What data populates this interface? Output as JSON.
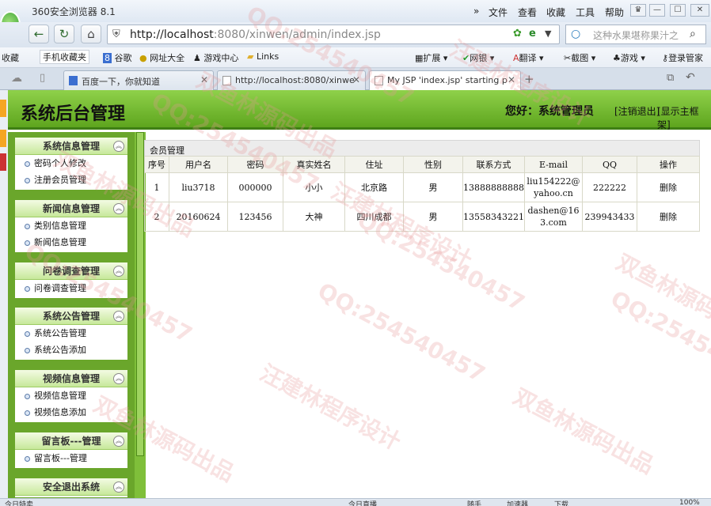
{
  "browser": {
    "app_title": "360安全浏览器 8.1",
    "menus": [
      "文件",
      "查看",
      "收藏",
      "工具",
      "帮助"
    ],
    "url_host": "http://localhost",
    "url_rest": ":8080/xinwen/admin/index.jsp",
    "search_placeholder": "这种水果堪称果汁之",
    "favorites": [
      "收藏",
      "手机收藏夹",
      "谷歌",
      "网址大全",
      "游戏中心",
      "Links",
      "扩展",
      "网银",
      "翻译",
      "截图",
      "游戏",
      "登录管家"
    ],
    "tabs": [
      {
        "label": "百度一下，你就知道",
        "active": false
      },
      {
        "label": "http://localhost:8080/xinwe",
        "active": false
      },
      {
        "label": "My JSP 'index.jsp' starting p",
        "active": true
      }
    ],
    "status_left": "今日特卖",
    "status_right": [
      "今日直播",
      "随手",
      "加速器",
      "下载",
      "100%"
    ]
  },
  "page": {
    "system_name": "系统后台管理",
    "greeting": "您好：系统管理员",
    "logout": "[注销退出]",
    "show_frame": "[显示主框架]",
    "breadcrumb": "会员管理"
  },
  "sidebar": {
    "groups": [
      {
        "title": "系统信息管理",
        "items": [
          "密码个人修改",
          "注册会员管理"
        ]
      },
      {
        "title": "新闻信息管理",
        "items": [
          "类别信息管理",
          "新闻信息管理"
        ]
      },
      {
        "title": "问卷调查管理",
        "items": [
          "问卷调查管理"
        ]
      },
      {
        "title": "系统公告管理",
        "items": [
          "系统公告管理",
          "系统公告添加"
        ]
      },
      {
        "title": "视频信息管理",
        "items": [
          "视频信息管理",
          "视频信息添加"
        ]
      },
      {
        "title": "留言板---管理",
        "items": [
          "留言板---管理"
        ]
      },
      {
        "title": "安全退出系统",
        "items": []
      }
    ]
  },
  "table": {
    "headers": [
      "序号",
      "用户名",
      "密码",
      "真实姓名",
      "住址",
      "性别",
      "联系方式",
      "E-mail",
      "QQ",
      "操作"
    ],
    "rows": [
      [
        "1",
        "liu3718",
        "000000",
        "小小",
        "北京路",
        "男",
        "13888888888",
        "liu154222@yahoo.cn",
        "222222",
        "删除"
      ],
      [
        "2",
        "20160624",
        "123456",
        "大神",
        "四川成都",
        "男",
        "13558343221",
        "dashen@163.com",
        "239943433",
        "删除"
      ]
    ]
  },
  "watermarks": [
    "QQ:254540457",
    "汪建林程序设计",
    "双鱼林源码出品"
  ]
}
